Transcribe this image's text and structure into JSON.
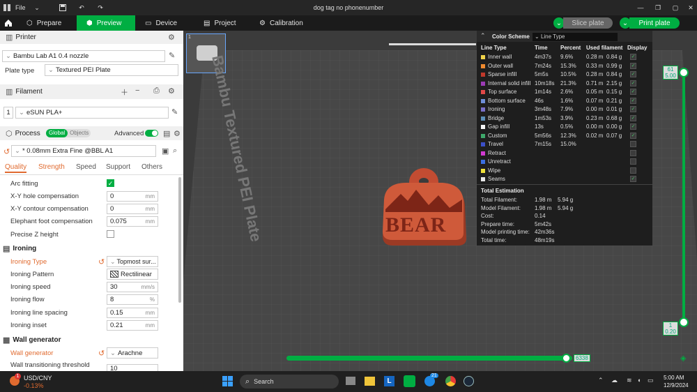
{
  "titlebar": {
    "file": "File",
    "title": "dog tag no phonenumber"
  },
  "nav": {
    "tabs": [
      "Prepare",
      "Preview",
      "Device",
      "Project",
      "Calibration"
    ],
    "slice": "Slice plate",
    "print": "Print plate"
  },
  "printer": {
    "header": "Printer",
    "name": "Bambu Lab A1 0.4 nozzle",
    "plate_label": "Plate type",
    "plate_value": "Textured PEI Plate"
  },
  "filament": {
    "header": "Filament",
    "index": "1",
    "name": "eSUN PLA+"
  },
  "process": {
    "header": "Process",
    "global": "Global",
    "objects": "Objects",
    "advanced": "Advanced",
    "preset": "* 0.08mm Extra Fine @BBL A1"
  },
  "tabs": [
    "Quality",
    "Strength",
    "Speed",
    "Support",
    "Others"
  ],
  "settings": {
    "arc": "Arc fitting",
    "xy_hole": {
      "label": "X-Y hole compensation",
      "value": "0",
      "unit": "mm"
    },
    "xy_contour": {
      "label": "X-Y contour compensation",
      "value": "0",
      "unit": "mm"
    },
    "elephant": {
      "label": "Elephant foot compensation",
      "value": "0.075",
      "unit": "mm"
    },
    "precise_z": "Precise Z height",
    "ironing_header": "Ironing",
    "ironing_type": {
      "label": "Ironing Type",
      "value": "Topmost sur..."
    },
    "ironing_pattern": {
      "label": "Ironing Pattern",
      "value": "Rectilinear"
    },
    "ironing_speed": {
      "label": "Ironing speed",
      "value": "30",
      "unit": "mm/s"
    },
    "ironing_flow": {
      "label": "Ironing flow",
      "value": "8",
      "unit": "%"
    },
    "ironing_spacing": {
      "label": "Ironing line spacing",
      "value": "0.15",
      "unit": "mm"
    },
    "ironing_inset": {
      "label": "Ironing inset",
      "value": "0.21",
      "unit": "mm"
    },
    "wall_header": "Wall generator",
    "wall_gen": {
      "label": "Wall generator",
      "value": "Arachne"
    },
    "wall_thresh": {
      "label": "Wall transitioning threshold",
      "value": "10"
    }
  },
  "viewport": {
    "plate_label": "Bambu Textured PEI Plate",
    "plate_num": "1",
    "model_text": "BEAR",
    "layer_top": "61",
    "layer_top_h": "5.00",
    "layer_bottom": "1",
    "layer_bottom_h": "0.20",
    "move_value": "6338"
  },
  "legend": {
    "title": "Color Scheme",
    "scheme": "Line Type",
    "headers": [
      "Line Type",
      "Time",
      "Percent",
      "Used filament",
      "Display"
    ],
    "rows": [
      {
        "name": "Inner wall",
        "time": "4m37s",
        "pct": "9.6%",
        "len": "0.28 m",
        "wt": "0.84 g",
        "color": "#f0d34a",
        "on": true
      },
      {
        "name": "Outer wall",
        "time": "7m24s",
        "pct": "15.3%",
        "len": "0.33 m",
        "wt": "0.99 g",
        "color": "#ef8a2f",
        "on": true
      },
      {
        "name": "Sparse infill",
        "time": "5m5s",
        "pct": "10.5%",
        "len": "0.28 m",
        "wt": "0.84 g",
        "color": "#c0392b",
        "on": true
      },
      {
        "name": "Internal solid infill",
        "time": "10m18s",
        "pct": "21.3%",
        "len": "0.71 m",
        "wt": "2.15 g",
        "color": "#9b3bb4",
        "on": true
      },
      {
        "name": "Top surface",
        "time": "1m14s",
        "pct": "2.6%",
        "len": "0.05 m",
        "wt": "0.15 g",
        "color": "#e04848",
        "on": true
      },
      {
        "name": "Bottom surface",
        "time": "46s",
        "pct": "1.6%",
        "len": "0.07 m",
        "wt": "0.21 g",
        "color": "#6f8fd8",
        "on": true
      },
      {
        "name": "Ironing",
        "time": "3m48s",
        "pct": "7.9%",
        "len": "0.00 m",
        "wt": "0.01 g",
        "color": "#7a6fc8",
        "on": true
      },
      {
        "name": "Bridge",
        "time": "1m53s",
        "pct": "3.9%",
        "len": "0.23 m",
        "wt": "0.68 g",
        "color": "#5c8fb8",
        "on": true
      },
      {
        "name": "Gap infill",
        "time": "13s",
        "pct": "0.5%",
        "len": "0.00 m",
        "wt": "0.00 g",
        "color": "#f5f5f5",
        "on": true
      },
      {
        "name": "Custom",
        "time": "5m56s",
        "pct": "12.3%",
        "len": "0.02 m",
        "wt": "0.07 g",
        "color": "#3ea86a",
        "on": true
      },
      {
        "name": "Travel",
        "time": "7m15s",
        "pct": "15.0%",
        "len": "",
        "wt": "",
        "color": "#3b4fc8",
        "on": false
      },
      {
        "name": "Retract",
        "time": "",
        "pct": "",
        "len": "",
        "wt": "",
        "color": "#d13bd1",
        "on": false
      },
      {
        "name": "Unretract",
        "time": "",
        "pct": "",
        "len": "",
        "wt": "",
        "color": "#3b6fe0",
        "on": false
      },
      {
        "name": "Wipe",
        "time": "",
        "pct": "",
        "len": "",
        "wt": "",
        "color": "#f0e13a",
        "on": false
      },
      {
        "name": "Seams",
        "time": "",
        "pct": "",
        "len": "",
        "wt": "",
        "color": "#e8e8e8",
        "on": true
      }
    ],
    "total_header": "Total Estimation",
    "totals": [
      {
        "label": "Total Filament:",
        "v1": "1.98 m",
        "v2": "5.94 g"
      },
      {
        "label": "Model Filament:",
        "v1": "1.98 m",
        "v2": "5.94 g"
      },
      {
        "label": "Cost:",
        "v1": "0.14",
        "v2": ""
      },
      {
        "label": "Prepare time:",
        "v1": "5m42s",
        "v2": ""
      },
      {
        "label": "Model printing time:",
        "v1": "42m36s",
        "v2": ""
      },
      {
        "label": "Total time:",
        "v1": "48m19s",
        "v2": ""
      }
    ]
  },
  "taskbar": {
    "ticker": "USD/CNY",
    "change": "-0.13%",
    "badge": "1",
    "search": "Search",
    "time": "5:00 AM",
    "date": "12/9/2024",
    "chrome_badge": "21"
  }
}
